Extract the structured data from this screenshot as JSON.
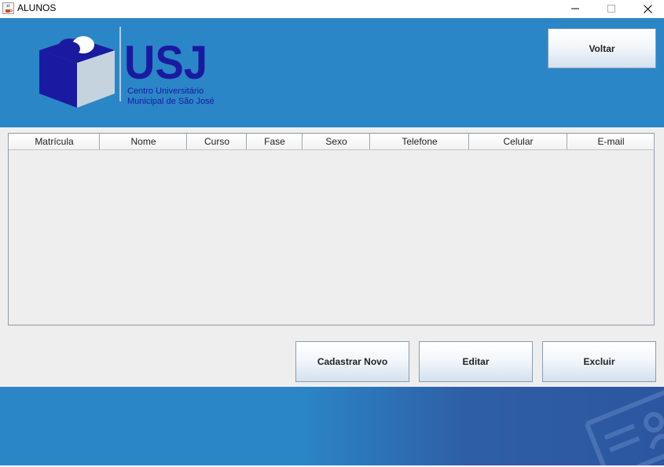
{
  "window": {
    "title": "ALUNOS",
    "icons": {
      "app": "java-cup-icon",
      "minimize": "minimize-icon",
      "maximize": "maximize-icon",
      "close": "close-icon"
    }
  },
  "header": {
    "logo": {
      "brand": "USJ",
      "line1": "Centro Universitário",
      "line2": "Municipal de São José"
    },
    "back_label": "Voltar"
  },
  "table": {
    "columns": [
      "Matrícula",
      "Nome",
      "Curso",
      "Fase",
      "Sexo",
      "Telefone",
      "Celular",
      "E-mail"
    ],
    "rows": []
  },
  "actions": {
    "new_label": "Cadastrar Novo",
    "edit_label": "Editar",
    "delete_label": "Excluir"
  },
  "colors": {
    "header_bg": "#2b86c7",
    "logo_navy": "#1a1aa0",
    "content_bg": "#eeeeee"
  }
}
